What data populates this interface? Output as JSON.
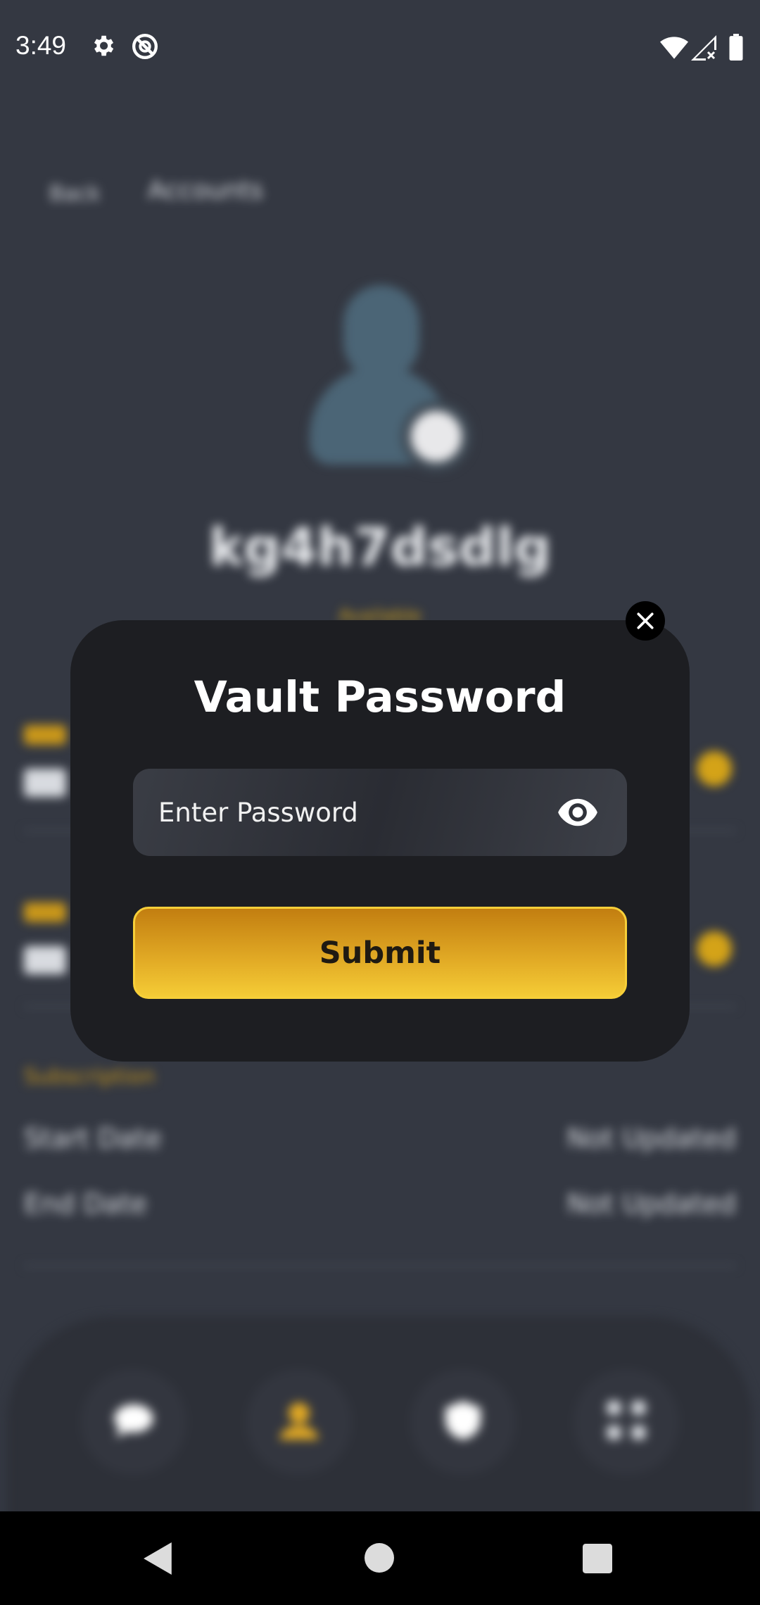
{
  "status_bar": {
    "time": "3:49",
    "icons": [
      "settings-icon",
      "do-not-disturb-icon",
      "wifi-icon",
      "cellular-no-data-icon",
      "battery-icon"
    ]
  },
  "background": {
    "back_label": "Back",
    "title": "Accounts",
    "username": "kg4h7dsdlg",
    "status": "Available",
    "subscription_section": "Subscription",
    "rows": [
      {
        "label": "Start Date",
        "value": "Not Updated"
      },
      {
        "label": "End Date",
        "value": "Not Updated"
      }
    ],
    "nav_icons": [
      "chat-icon",
      "profile-icon",
      "shield-icon",
      "apps-grid-icon"
    ]
  },
  "modal": {
    "title": "Vault Password",
    "password_placeholder": "Enter Password",
    "password_value": "",
    "submit_label": "Submit",
    "close_icon": "close-icon",
    "toggle_icon": "eye-icon"
  },
  "colors": {
    "accent": "#e0a824",
    "modal_bg": "#1d1e22",
    "screen_bg": "#343842"
  },
  "system_nav": [
    "back-icon",
    "home-icon",
    "recents-icon"
  ]
}
